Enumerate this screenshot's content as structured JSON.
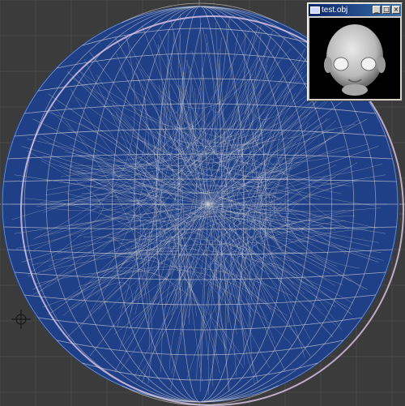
{
  "viewport": {
    "background": "#3b3b3b",
    "grid_color": "#4a4a4a",
    "axis_color": "#9a9a9a",
    "mesh_fill": "#1f3f86",
    "wire_color": "#d8d8d8",
    "selected_wire_color": "#e0c8ee"
  },
  "cursor": {
    "icon": "crosshair-cursor-icon"
  },
  "preview_window": {
    "title": "test.obj",
    "buttons": {
      "minimize": "_",
      "maximize": "□",
      "close": "×"
    },
    "background": "#000000",
    "model_color": "#bdbdbd"
  }
}
